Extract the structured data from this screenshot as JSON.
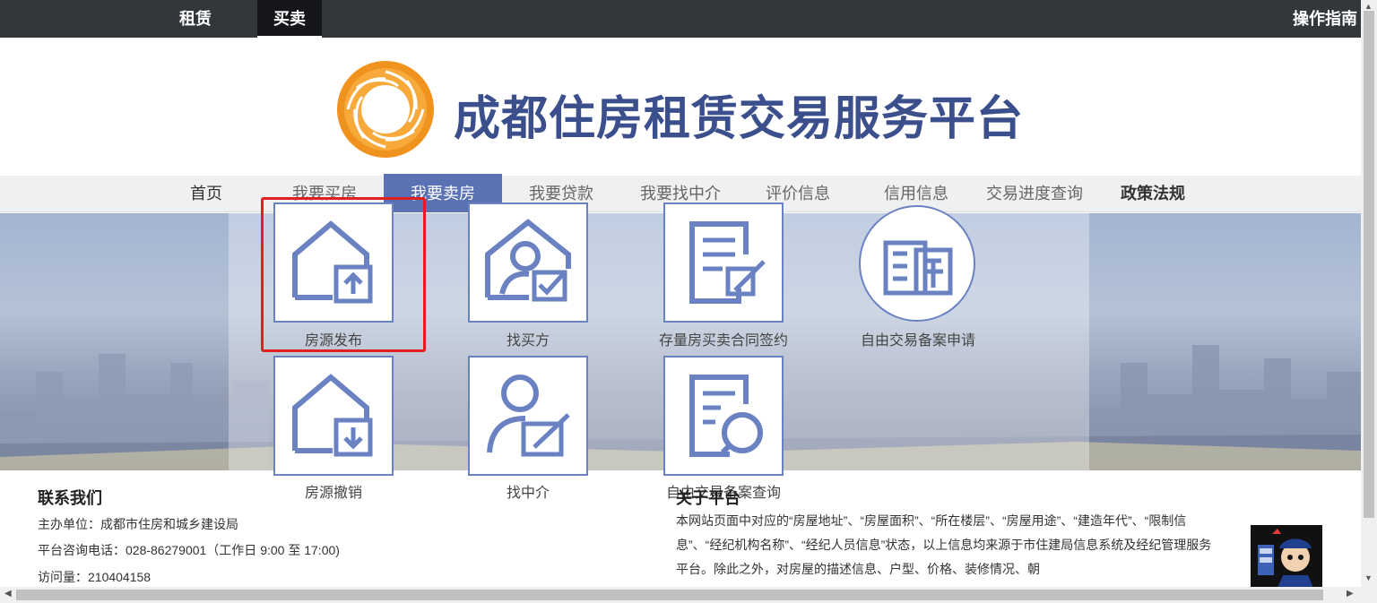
{
  "topbar": {
    "tabs": [
      {
        "label": "租赁"
      },
      {
        "label": "买卖"
      }
    ],
    "guide": "操作指南"
  },
  "header": {
    "title": "成都住房租赁交易服务平台"
  },
  "nav": {
    "items": [
      {
        "label": "首页"
      },
      {
        "label": "我要买房"
      },
      {
        "label": "我要卖房"
      },
      {
        "label": "我要贷款"
      },
      {
        "label": "我要找中介"
      },
      {
        "label": "评价信息"
      },
      {
        "label": "信用信息"
      },
      {
        "label": "交易进度查询"
      },
      {
        "label": "政策法规"
      }
    ]
  },
  "menu": {
    "tiles": [
      {
        "label": "房源发布",
        "icon": "house-upload-icon"
      },
      {
        "label": "找买方",
        "icon": "person-house-check-icon"
      },
      {
        "label": "存量房买卖合同签约",
        "icon": "contract-sign-icon"
      },
      {
        "label": "自由交易备案申请",
        "icon": "filing-application-icon"
      },
      {
        "label": "房源撤销",
        "icon": "house-download-icon"
      },
      {
        "label": "找中介",
        "icon": "person-edit-icon"
      },
      {
        "label": "自由交易备案查询",
        "icon": "filing-search-icon"
      }
    ]
  },
  "footer": {
    "contact": {
      "title": "联系我们",
      "org": "主办单位：成都市住房和城乡建设局",
      "phone": "平台咨询电话：028-86279001（工作日 9:00 至 17:00)",
      "visits": "访问量：210404158"
    },
    "about": {
      "title": "关于平台",
      "text": "本网站页面中对应的“房屋地址”、“房屋面积”、“所在楼层”、“房屋用途”、“建造年代”、“限制信息”、“经纪机构名称”、“经纪人员信息”状态，以上信息均来源于市住建局信息系统及经纪管理服务平台。除此之外，对房屋的描述信息、户型、价格、装修情况、朝"
    }
  },
  "colors": {
    "topbar": "#32373c",
    "accent": "#5a72b3",
    "title": "#3b4f8c",
    "icon": "#6a81c2",
    "highlight": "#e02020",
    "logo": "#f0921e"
  }
}
